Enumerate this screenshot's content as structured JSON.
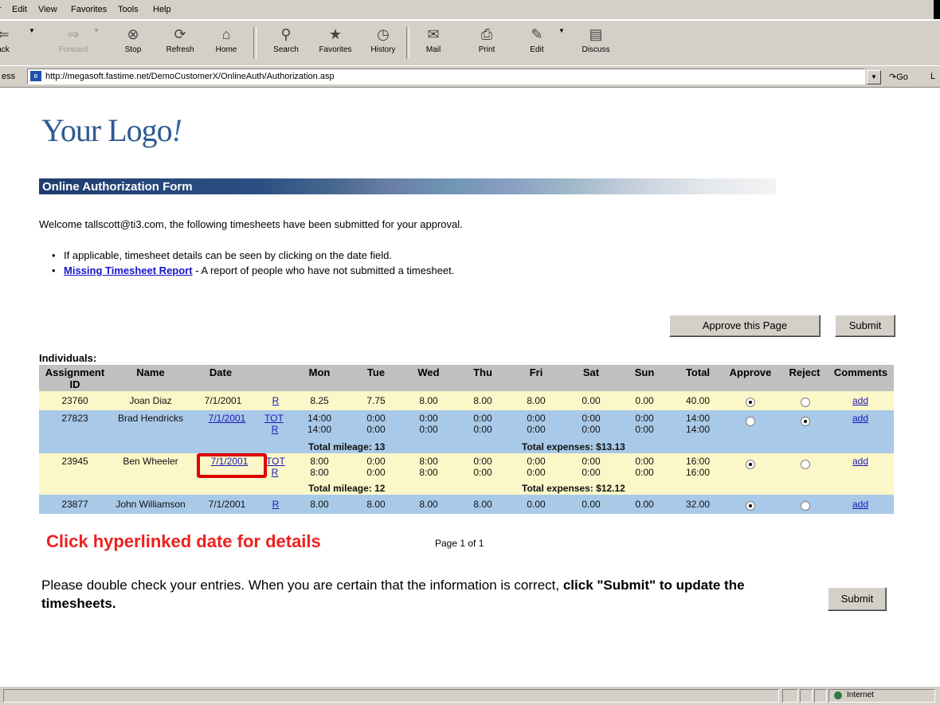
{
  "menu": [
    "Edit",
    "View",
    "Favorites",
    "Tools",
    "Help"
  ],
  "toolbar": {
    "back": "ack",
    "forward": "Forward",
    "stop": "Stop",
    "refresh": "Refresh",
    "home": "Home",
    "search": "Search",
    "favorites": "Favorites",
    "history": "History",
    "mail": "Mail",
    "print": "Print",
    "edit": "Edit",
    "discuss": "Discuss"
  },
  "address": {
    "label": "ess",
    "url": "http://megasoft.fastime.net/DemoCustomerX/OnlineAuth/Authorization.asp",
    "go": "Go",
    "links": "L"
  },
  "logo": {
    "text": "Your Logo",
    "mark": "!"
  },
  "banner": "Online Authorization Form",
  "welcome": "Welcome tallscott@ti3.com, the following timesheets have been submitted for your approval.",
  "bullets": {
    "first": "If applicable, timesheet details can be seen by clicking on the date field.",
    "link": "Missing Timesheet Report",
    "second_rest": " - A report of people who have not submitted a timesheet."
  },
  "buttons": {
    "approve_page": "Approve this Page",
    "submit": "Submit"
  },
  "table": {
    "section": "Individuals:",
    "headers": {
      "assignment_line1": "Assignment",
      "assignment_line2": "ID",
      "name": "Name",
      "date": "Date",
      "mon": "Mon",
      "tue": "Tue",
      "wed": "Wed",
      "thu": "Thu",
      "fri": "Fri",
      "sat": "Sat",
      "sun": "Sun",
      "total": "Total",
      "approve": "Approve",
      "reject": "Reject",
      "comments": "Comments"
    },
    "rows": [
      {
        "id": "23760",
        "name": "Joan Diaz",
        "date": "7/1/2001",
        "tot": "",
        "r": "R",
        "days_line1": [
          "8.25",
          "7.75",
          "8.00",
          "8.00",
          "8.00",
          "0.00",
          "0.00"
        ],
        "total_line1": "40.00",
        "approve": true,
        "reject": false,
        "comment": "add"
      },
      {
        "id": "27823",
        "name": "Brad Hendricks",
        "date": "7/1/2001",
        "tot": "TOT",
        "r": "R",
        "days_line1": [
          "14:00",
          "0:00",
          "0:00",
          "0:00",
          "0:00",
          "0:00",
          "0:00"
        ],
        "days_line2": [
          "14:00",
          "0:00",
          "0:00",
          "0:00",
          "0:00",
          "0:00",
          "0:00"
        ],
        "total_line1": "14:00",
        "total_line2": "14:00",
        "mileage": "Total mileage: 13",
        "expenses": "Total expenses: $13.13",
        "approve": false,
        "reject": true,
        "comment": "add"
      },
      {
        "id": "23945",
        "name": "Ben Wheeler",
        "date": "7/1/2001",
        "tot": "TOT",
        "r": "R",
        "days_line1": [
          "8:00",
          "0:00",
          "8:00",
          "0:00",
          "0:00",
          "0:00",
          "0:00"
        ],
        "days_line2": [
          "8:00",
          "0:00",
          "8:00",
          "0:00",
          "0:00",
          "0:00",
          "0:00"
        ],
        "total_line1": "16:00",
        "total_line2": "16:00",
        "mileage": "Total mileage: 12",
        "expenses": "Total expenses: $12.12",
        "approve": true,
        "reject": false,
        "comment": "add"
      },
      {
        "id": "23877",
        "name": "John Williamson",
        "date": "7/1/2001",
        "tot": "",
        "r": "R",
        "days_line1": [
          "8.00",
          "8.00",
          "8.00",
          "8.00",
          "0.00",
          "0.00",
          "0.00"
        ],
        "total_line1": "32.00",
        "approve": true,
        "reject": false,
        "comment": "add"
      }
    ]
  },
  "click_message": "Click hyperlinked date for details",
  "page_info": "Page 1 of 1",
  "note": {
    "text": "Please double check your entries. When you are certain that the information is correct, ",
    "bold": "click \"Submit\" to update the timesheets."
  },
  "status": {
    "zone": "Internet"
  },
  "colors": {
    "banner_dark": "#1e3c6e",
    "row_yellow": "#fbf7c8",
    "row_blue": "#a9c9e8",
    "highlight": "#e00000",
    "click_message": "#ee2020"
  }
}
